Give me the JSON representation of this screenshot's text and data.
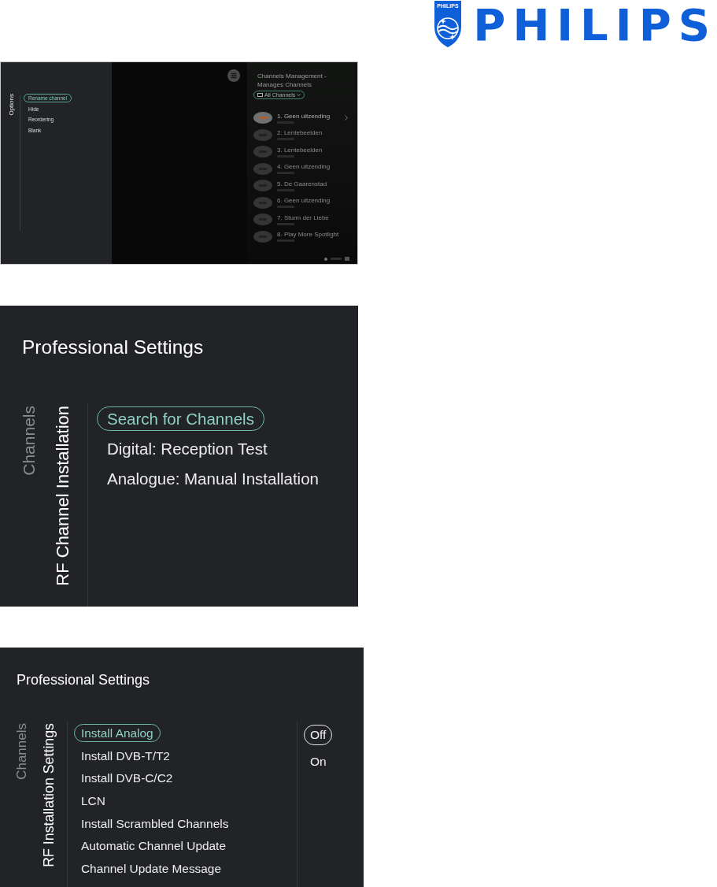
{
  "logo": {
    "emblem_text": "PHILIPS",
    "wordmark": "PHILIPS"
  },
  "screens": [
    {
      "kind": "channel_options",
      "sidebar_title": "Options",
      "options": [
        {
          "label": "Rename channel",
          "selected": true
        },
        {
          "label": "Hide",
          "selected": false
        },
        {
          "label": "Reordering",
          "selected": false
        },
        {
          "label": "Blank",
          "selected": false
        }
      ],
      "list_title": "Channels Management - Manages Channels",
      "filter": "All Channels",
      "channels": [
        {
          "title": "1. Geen uitzending",
          "selected": true
        },
        {
          "title": "2. Lentebeelden",
          "selected": false
        },
        {
          "title": "3. Lentebeelden",
          "selected": false
        },
        {
          "title": "4. Geen uitzending",
          "selected": false
        },
        {
          "title": "5. De Gaarenstad",
          "selected": false
        },
        {
          "title": "6. Geen uitzending",
          "selected": false
        },
        {
          "title": "7. Sturm der Liebe",
          "selected": false
        },
        {
          "title": "8. Play More Spotlight",
          "selected": false
        }
      ]
    },
    {
      "kind": "settings_menu",
      "title": "Professional Settings",
      "breadcrumb": "Channels",
      "section": "RF Channel Installation",
      "items": [
        {
          "label": "Search for Channels",
          "selected": true
        },
        {
          "label": "Digital: Reception Test",
          "selected": false
        },
        {
          "label": "Analogue: Manual Installation",
          "selected": false
        }
      ]
    },
    {
      "kind": "settings_menu",
      "title": "Professional Settings",
      "breadcrumb": "Channels",
      "section": "RF Installation Settings",
      "items": [
        {
          "label": "Install Analog",
          "selected": true
        },
        {
          "label": "Install DVB-T/T2",
          "selected": false
        },
        {
          "label": "Install DVB-C/C2",
          "selected": false
        },
        {
          "label": "LCN",
          "selected": false
        },
        {
          "label": "Install Scrambled Channels",
          "selected": false
        },
        {
          "label": "Automatic Channel Update",
          "selected": false
        },
        {
          "label": "Channel Update Message",
          "selected": false
        }
      ],
      "values": [
        {
          "label": "Off",
          "selected": true
        },
        {
          "label": "On",
          "selected": false
        }
      ]
    }
  ]
}
